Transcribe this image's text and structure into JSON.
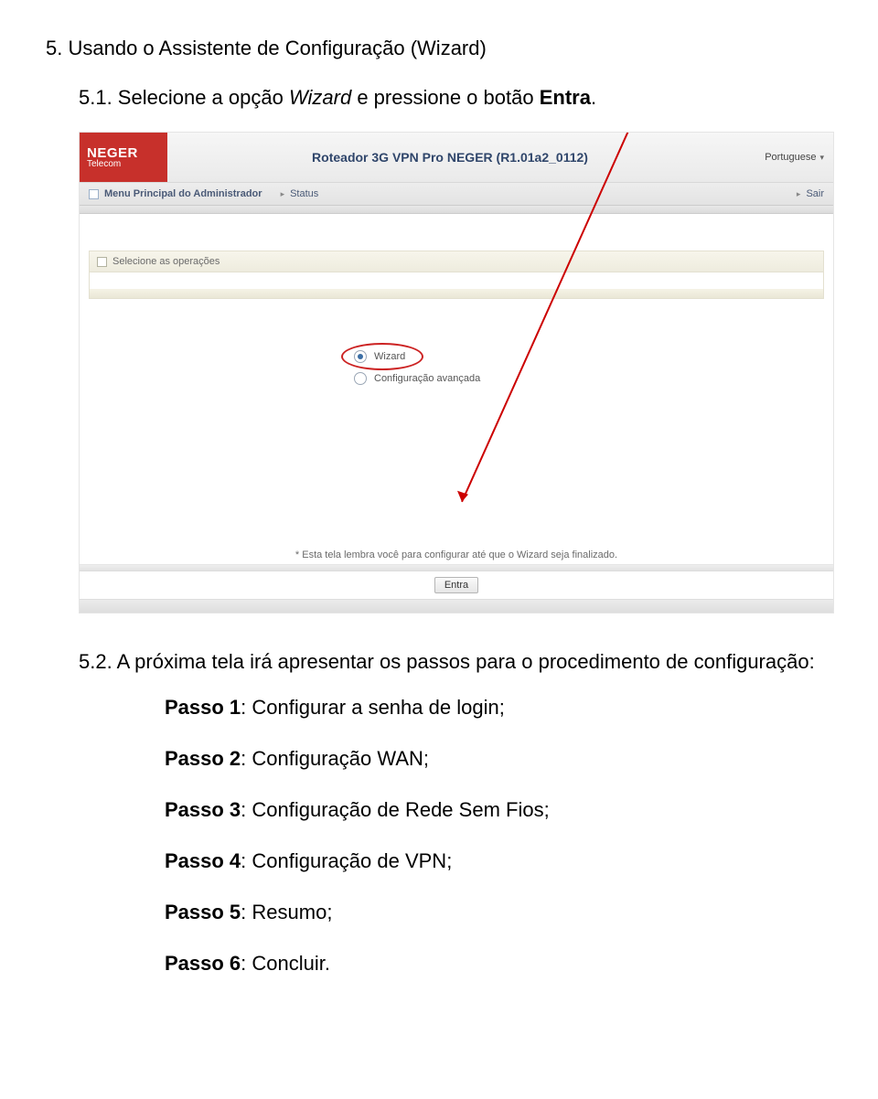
{
  "doc": {
    "heading_num": "5.",
    "heading_text": "Usando o Assistente de Configuração (Wizard)",
    "p1_prefix": "5.1.  Selecione a opção ",
    "p1_italic": "Wizard",
    "p1_mid": " e pressione o botão ",
    "p1_bold": "Entra",
    "p1_suffix": ".",
    "p2": "5.2.  A próxima tela irá apresentar os passos para o procedimento de configuração:"
  },
  "shot": {
    "logo_line1": "NEGER",
    "logo_line2": "Telecom",
    "title": "Roteador 3G VPN Pro NEGER (R1.01a2_0112)",
    "lang": "Portuguese",
    "menu_main": "Menu Principal do Administrador",
    "menu_status": "Status",
    "menu_exit": "Sair",
    "sel_ops": "Selecione as operações",
    "opt_wizard": "Wizard",
    "opt_adv": "Configuração avançada",
    "foot_note": "* Esta tela lembra você para configurar até que o Wizard seja finalizado.",
    "btn": "Entra"
  },
  "steps": {
    "s1_b": "Passo 1",
    "s1_t": ": Configurar a senha de login;",
    "s2_b": "Passo 2",
    "s2_t": ": Configuração WAN;",
    "s3_b": "Passo 3",
    "s3_t": ": Configuração de Rede Sem Fios;",
    "s4_b": "Passo 4",
    "s4_t": ": Configuração de VPN;",
    "s5_b": "Passo 5",
    "s5_t": ": Resumo;",
    "s6_b": "Passo 6",
    "s6_t": ": Concluir."
  }
}
